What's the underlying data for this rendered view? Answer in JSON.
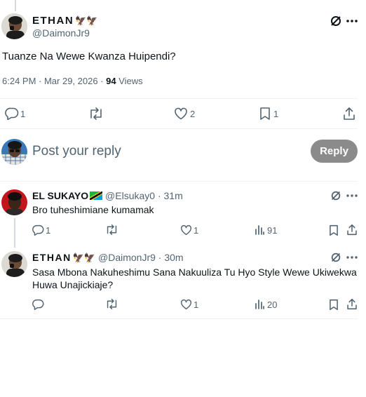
{
  "main_tweet": {
    "author_name": "ETHAN",
    "author_emojis": "🦅🦅",
    "handle": "@DaimonJr9",
    "text": "Tuanze Na Wewe Kwanza Huipendi?",
    "time": "6:24 PM · Mar 29, 2026 · ",
    "views_count": "94",
    "views_label": " Views",
    "actions": {
      "replies": "1",
      "retweets": "",
      "likes": "2",
      "bookmarks": "1"
    }
  },
  "composer": {
    "placeholder": "Post your reply",
    "reply_label": "Reply"
  },
  "replies": [
    {
      "author_name": "EL SUKAYO",
      "handle": "@Elsukay0",
      "age": " · 31m",
      "text": "Bro tuheshimiane kumamak",
      "replies": "1",
      "retweets": "",
      "likes": "1",
      "views": "91"
    },
    {
      "author_name": "ETHAN",
      "author_emojis": "🦅🦅",
      "handle": "@DaimonJr9",
      "age": " · 30m",
      "text_line1": "Sasa Mbona Nakuheshimu Sana Nakuuliza Tu Hyo Style Wewe Ukiwekwa",
      "text_line2": "Huwa Unajickiaje?",
      "replies": "",
      "retweets": "",
      "likes": "1",
      "views": "20"
    }
  ],
  "colors": {
    "text": "#0f1419",
    "muted": "#536471",
    "divider": "#eff3f4",
    "reply_button": "#8b8b8b"
  },
  "icons": [
    "grok-icon",
    "more-icon",
    "reply-icon",
    "retweet-icon",
    "like-icon",
    "bookmark-icon",
    "share-icon",
    "views-icon"
  ]
}
